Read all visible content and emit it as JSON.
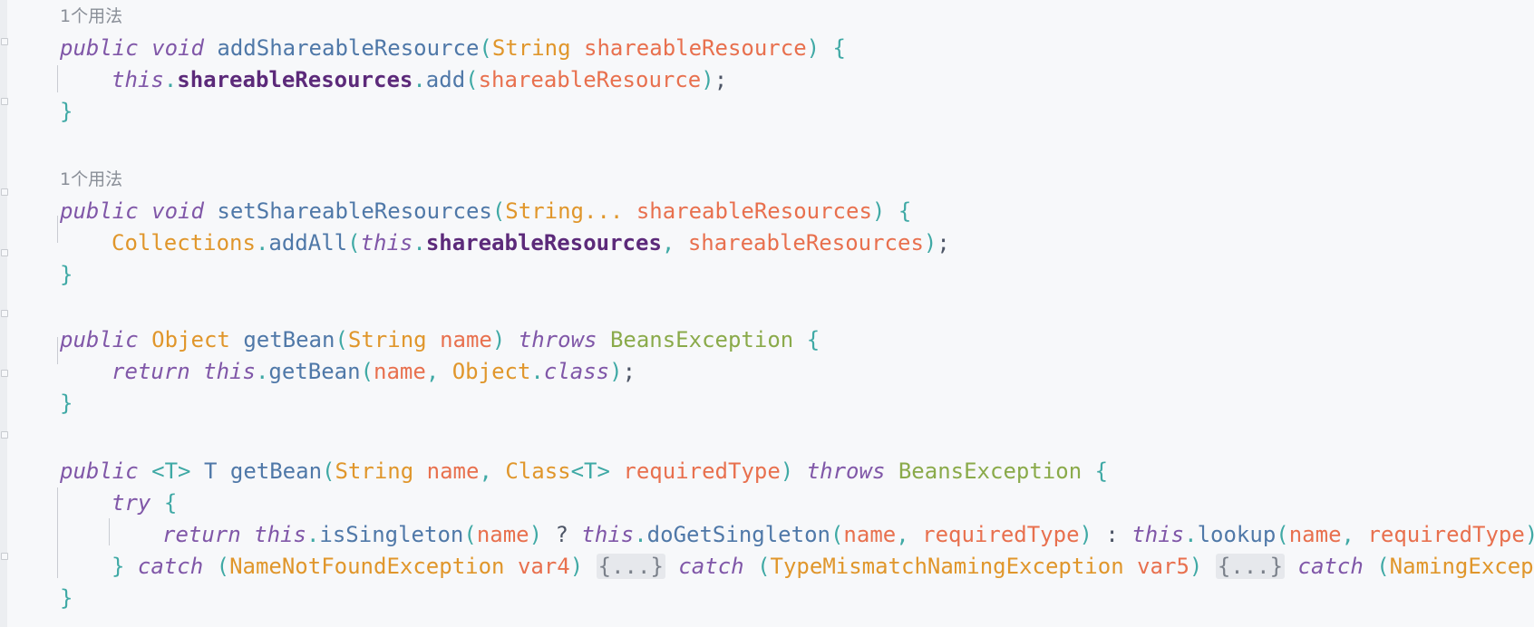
{
  "editor": {
    "usage_hint_1": "1个用法",
    "usage_hint_2": "1个用法",
    "m1": {
      "public": "public",
      "void": "void",
      "name": "addShareableResource",
      "lp": "(",
      "ptype": "String",
      "pname": "shareableResource",
      "rp": ")",
      "lb": "{",
      "body_this": "this",
      "body_dot": ".",
      "body_field": "shareableResources",
      "body_dot2": ".",
      "body_call": "add",
      "body_lp": "(",
      "body_arg": "shareableResource",
      "body_rp": ")",
      "body_semi": ";",
      "rb": "}"
    },
    "m2": {
      "public": "public",
      "void": "void",
      "name": "setShareableResources",
      "lp": "(",
      "ptype": "String",
      "dots": "...",
      "pname": "shareableResources",
      "rp": ")",
      "lb": "{",
      "body_cls": "Collections",
      "body_dot": ".",
      "body_call": "addAll",
      "body_lp": "(",
      "body_this": "this",
      "body_dot2": ".",
      "body_field": "shareableResources",
      "body_comma": ",",
      "body_arg": "shareableResources",
      "body_rp": ")",
      "body_semi": ";",
      "rb": "}"
    },
    "m3": {
      "public": "public",
      "rtype": "Object",
      "name": "getBean",
      "lp": "(",
      "ptype": "String",
      "pname": "name",
      "rp": ")",
      "throws": "throws",
      "exc": "BeansException",
      "lb": "{",
      "body_return": "return",
      "body_this": "this",
      "body_dot": ".",
      "body_call": "getBean",
      "body_lp": "(",
      "body_arg": "name",
      "body_comma": ",",
      "body_cls": "Object",
      "body_dot2": ".",
      "body_class": "class",
      "body_rp": ")",
      "body_semi": ";",
      "rb": "}"
    },
    "m4": {
      "public": "public",
      "generic": "<T>",
      "rtype": "T",
      "name": "getBean",
      "lp": "(",
      "ptype": "String",
      "pname": "name",
      "comma": ",",
      "ptype2": "Class",
      "gen2": "<T>",
      "pname2": "requiredType",
      "rp": ")",
      "throws": "throws",
      "exc": "BeansException",
      "lb": "{",
      "try": "try",
      "try_lb": "{",
      "ret": "return",
      "this1": "this",
      "dot1": ".",
      "call1": "isSingleton",
      "lp1": "(",
      "arg1": "name",
      "rp1": ")",
      "q": "?",
      "this2": "this",
      "dot2": ".",
      "call2": "doGetSingleton",
      "lp2": "(",
      "arg2a": "name",
      "c2": ",",
      "arg2b": "requiredType",
      "rp2": ")",
      "colon": ":",
      "this3": "this",
      "dot3": ".",
      "call3": "lookup",
      "lp3": "(",
      "arg3a": "name",
      "c3": ",",
      "arg3b": "requiredType",
      "rp3": ")",
      "semi": ";",
      "rb_try": "}",
      "catch1": "catch",
      "c1lp": "(",
      "c1type": "NameNotFoundException",
      "c1var": "var4",
      "c1rp": ")",
      "fold1": "{...}",
      "catch2": "catch",
      "c2lp": "(",
      "c2type": "TypeMismatchNamingException",
      "c2var": "var5",
      "c2rp": ")",
      "fold2": "{...}",
      "catch3": "catch",
      "c3lp": "(",
      "c3type": "NamingException",
      "rb": "}"
    }
  }
}
